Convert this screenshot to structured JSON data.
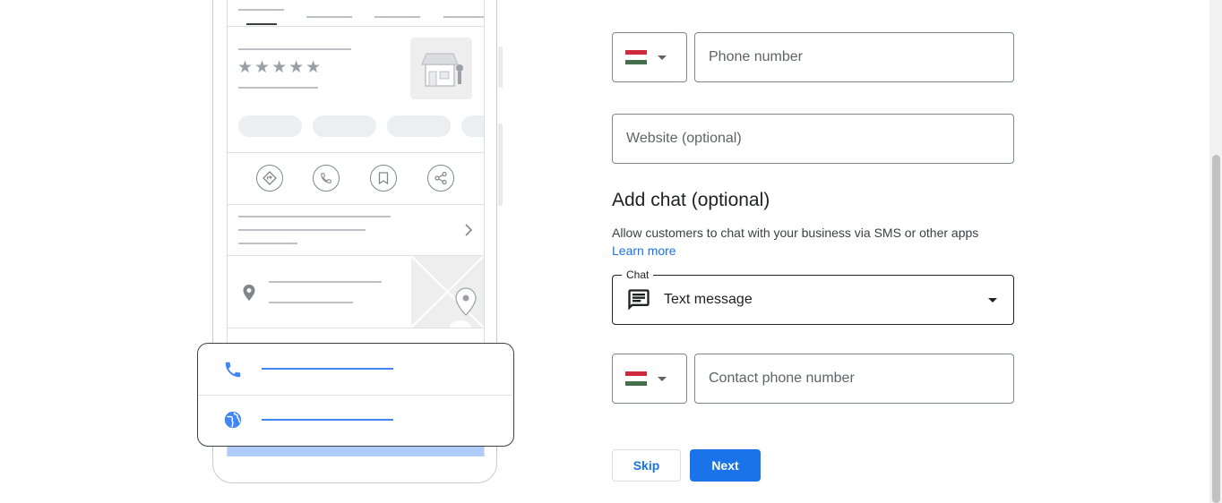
{
  "form": {
    "phone": {
      "placeholder": "Phone number",
      "country_flag": "hungary-flag"
    },
    "website": {
      "placeholder": "Website (optional)"
    },
    "chat_section": {
      "heading": "Add chat (optional)",
      "description": "Allow customers to chat with your business via SMS or other apps",
      "learn_more": "Learn more",
      "select_label": "Chat",
      "selected": "Text message",
      "selected_icon": "chat-bubble-icon"
    },
    "contact_phone": {
      "placeholder": "Contact phone number",
      "country_flag": "hungary-flag"
    },
    "buttons": {
      "skip": "Skip",
      "next": "Next"
    }
  },
  "illustration": {
    "rating_stars": "★★★★★",
    "action_icons": [
      "directions-icon",
      "phone-icon",
      "bookmark-icon",
      "share-icon"
    ],
    "overlay_rows": [
      "phone-icon",
      "globe-icon"
    ]
  },
  "colors": {
    "accent": "#1a73e8",
    "flag_red": "#cd2a3e",
    "flag_white": "#ffffff",
    "flag_green": "#436f4d"
  }
}
